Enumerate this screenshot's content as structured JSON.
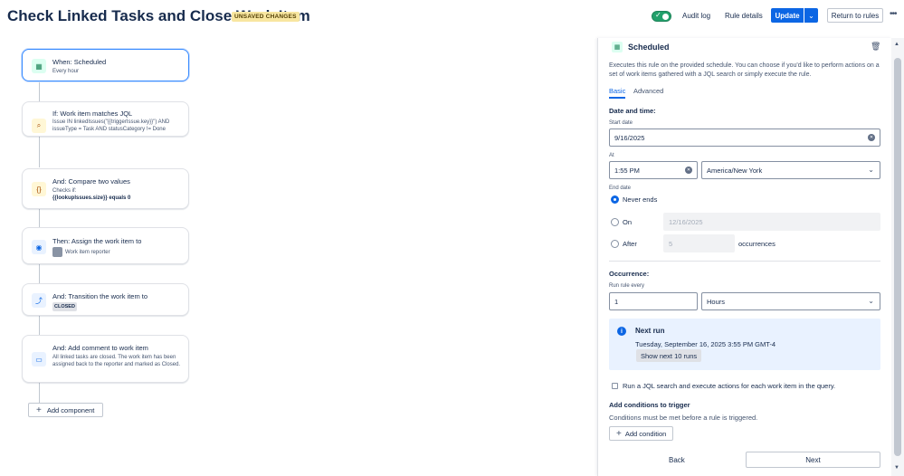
{
  "header": {
    "title": "Check Linked Tasks and Close Work Item",
    "badge": "UNSAVED CHANGES",
    "audit_log": "Audit log",
    "rule_details": "Rule details",
    "update": "Update",
    "return": "Return to rules"
  },
  "canvas": {
    "nodes": [
      {
        "title": "When: Scheduled",
        "sub": "Every hour"
      },
      {
        "title": "If: Work item matches JQL",
        "sub": "Issue IN linkedIssues(\"{{triggerIssue.key}}\") AND issueType = Task AND statusCategory != Done"
      },
      {
        "title": "And: Compare two values",
        "sub1": "Checks if:",
        "sub2": "{{lookupIssues.size}} equals 0"
      },
      {
        "title": "Then: Assign the work item to",
        "sub": "Work item reporter"
      },
      {
        "title": "And: Transition the work item to",
        "sub": "CLOSED"
      },
      {
        "title": "And: Add comment to work item",
        "sub": "All linked tasks are closed. The work item has been assigned back to the reporter and marked as Closed."
      }
    ],
    "add_component": "Add component"
  },
  "panel": {
    "title": "Scheduled",
    "description": "Executes this rule on the provided schedule. You can choose if you'd like to perform actions on a set of work items gathered with a JQL search or simply execute the rule.",
    "tabs": {
      "basic": "Basic",
      "advanced": "Advanced"
    },
    "date_time": "Date and time:",
    "start_date_label": "Start date",
    "start_date": "9/16/2025",
    "at_label": "At",
    "time": "1:55 PM",
    "timezone": "America/New York",
    "end_date_label": "End date",
    "never_ends": "Never ends",
    "on": "On",
    "on_date": "12/16/2025",
    "after": "After",
    "after_count": "5",
    "occurrences": "occurrences",
    "occurrence": "Occurrence:",
    "run_every_label": "Run rule every",
    "run_every_value": "1",
    "unit": "Hours",
    "next_run_title": "Next run",
    "next_run_date": "Tuesday, September 16, 2025 3:55 PM GMT-4",
    "show_next": "Show next 10 runs",
    "jql_checkbox": "Run a JQL search and execute actions for each work item in the query.",
    "add_conditions_title": "Add conditions to trigger",
    "add_conditions_desc": "Conditions must be met before a rule is triggered.",
    "add_condition": "Add condition",
    "back": "Back",
    "next": "Next"
  },
  "colors": {
    "primary": "#0c66e4",
    "toggle_on": "#22a06b",
    "badge_bg": "#f8e6a0",
    "info_bg": "#e9f2ff"
  },
  "icons": [
    "calendar-icon",
    "search-icon",
    "braces-icon",
    "user-circle-icon",
    "transition-icon",
    "comment-icon",
    "trash-icon",
    "info-icon",
    "chevron-down-icon",
    "clear-icon",
    "plus-icon",
    "more-icon"
  ]
}
